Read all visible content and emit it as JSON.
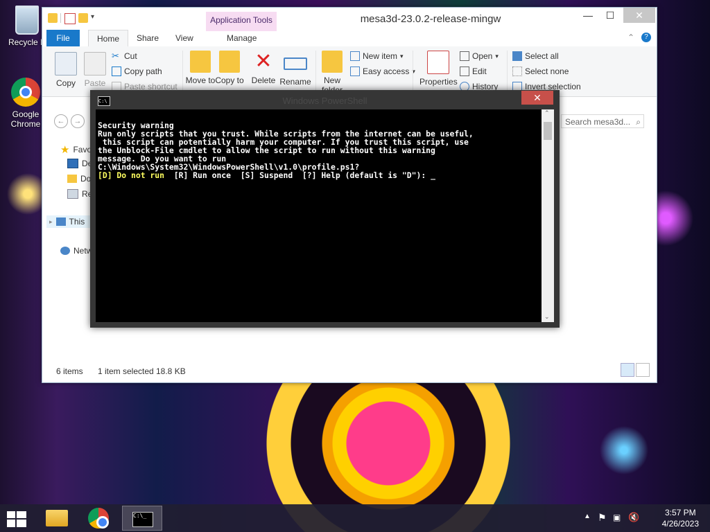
{
  "desktop": {
    "icons": [
      {
        "label": "Recycle B"
      },
      {
        "label": "Google Chrome"
      }
    ]
  },
  "explorer": {
    "title": "mesa3d-23.0.2-release-mingw",
    "context_tab": "Application Tools",
    "tabs": {
      "file": "File",
      "home": "Home",
      "share": "Share",
      "view": "View",
      "manage": "Manage"
    },
    "ribbon": {
      "copy": "Copy",
      "paste": "Paste",
      "cut": "Cut",
      "copy_path": "Copy path",
      "paste_shortcut": "Paste shortcut",
      "move_to": "Move to",
      "copy_to": "Copy to",
      "delete": "Delete",
      "rename": "Rename",
      "new_folder": "New folder",
      "new_item": "New item",
      "easy_access": "Easy access",
      "properties": "Properties",
      "open": "Open",
      "edit": "Edit",
      "history": "History",
      "select_all": "Select all",
      "select_none": "Select none",
      "invert_selection": "Invert selection"
    },
    "search_placeholder": "Search mesa3d...",
    "nav": {
      "favorites": "Favo",
      "desktop": "De",
      "downloads": "Do",
      "recent": "Re",
      "this_pc": "This",
      "network": "Netw"
    },
    "status": {
      "items": "6 items",
      "selected": "1 item selected",
      "size": "18.8 KB"
    }
  },
  "powershell": {
    "title": "Windows PowerShell",
    "console": {
      "line1": "Security warning",
      "line2": "Run only scripts that you trust. While scripts from the internet can be useful,",
      "line3": " this script can potentially harm your computer. If you trust this script, use",
      "line4": "the Unblock-File cmdlet to allow the script to run without this warning",
      "line5": "message. Do you want to run",
      "line6": "C:\\Windows\\System32\\WindowsPowerShell\\v1.0\\profile.ps1?",
      "prompt_default": "[D] Do not run",
      "prompt_rest": "  [R] Run once  [S] Suspend  [?] Help (default is \"D\"): ",
      "cursor": "_"
    }
  },
  "taskbar": {
    "time": "3:57 PM",
    "date": "4/26/2023"
  }
}
